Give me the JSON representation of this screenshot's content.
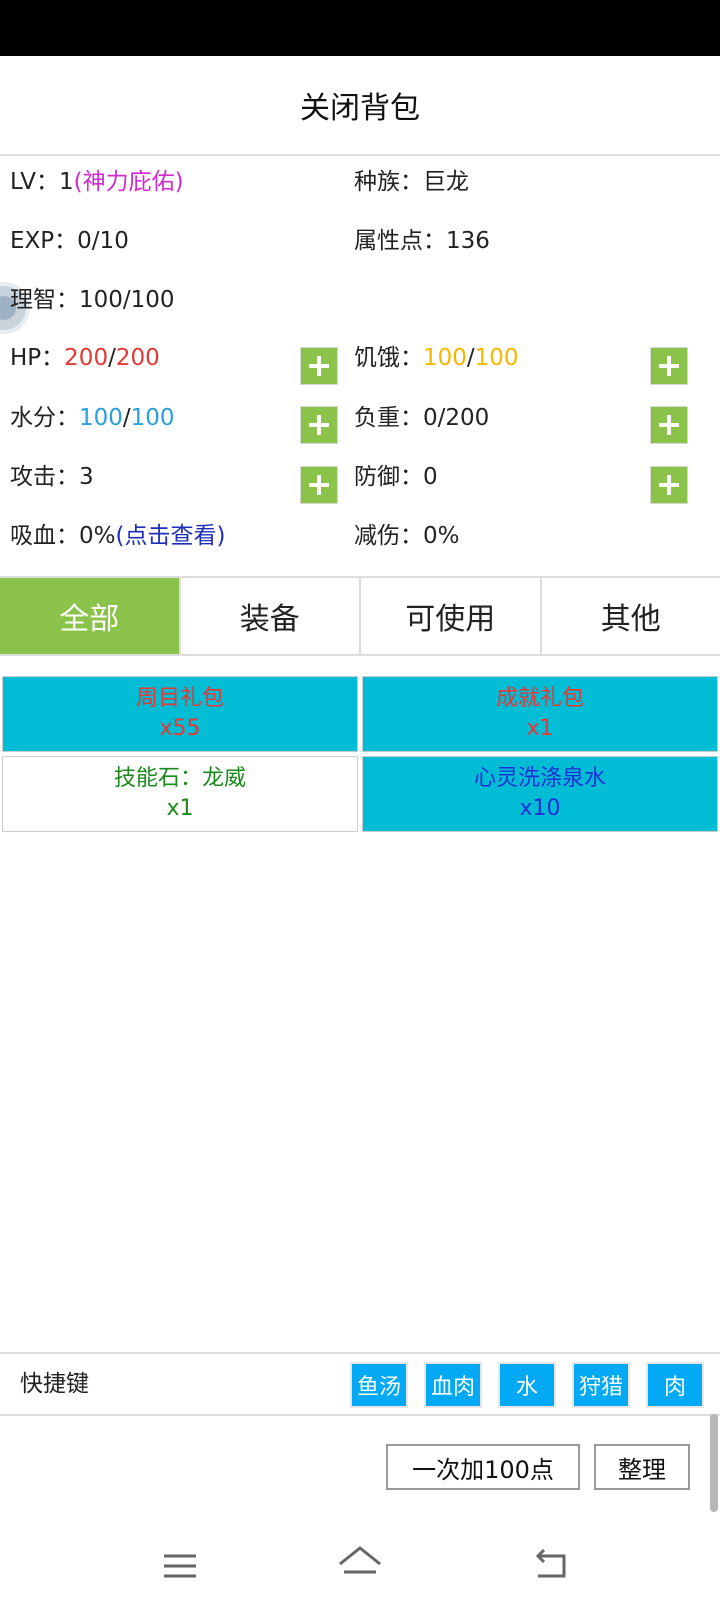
{
  "header": {
    "title": "关闭背包"
  },
  "stats": {
    "lv_label": "LV：",
    "lv_value": "1",
    "lv_note": "(神力庇佑)",
    "race_label": "种族：",
    "race_value": "巨龙",
    "exp_label": "EXP：",
    "exp_value": "0/10",
    "attr_label": "属性点：",
    "attr_value": "136",
    "sanity_label": "理智：",
    "sanity_value": "100/100",
    "hp_label": "HP：",
    "hp_current": "200",
    "hp_sep": "/",
    "hp_max": "200",
    "hunger_label": "饥饿：",
    "hunger_current": "100",
    "hunger_sep": "/",
    "hunger_max": "100",
    "water_label": "水分：",
    "water_current": "100",
    "water_sep": "/",
    "water_max": "100",
    "load_label": "负重：",
    "load_value": "0/200",
    "attack_label": "攻击：",
    "attack_value": "3",
    "defense_label": "防御：",
    "defense_value": "0",
    "lifesteal_label": "吸血：",
    "lifesteal_value": "0%",
    "lifesteal_link": "(点击查看)",
    "dmgreduce_label": "减伤：",
    "dmgreduce_value": "0%"
  },
  "tabs": [
    {
      "label": "全部",
      "active": true
    },
    {
      "label": "装备",
      "active": false
    },
    {
      "label": "可使用",
      "active": false
    },
    {
      "label": "其他",
      "active": false
    }
  ],
  "items": [
    {
      "name": "周目礼包",
      "count": "x55",
      "bg": "#00bcd4",
      "color": "#e53935"
    },
    {
      "name": "成就礼包",
      "count": "x1",
      "bg": "#00bcd4",
      "color": "#e53935"
    },
    {
      "name": "技能石：龙威",
      "count": "x1",
      "bg": "#ffffff",
      "color": "#1b8a1b"
    },
    {
      "name": "心灵洗涤泉水",
      "count": "x10",
      "bg": "#00bcd4",
      "color": "#1e2fd6"
    }
  ],
  "shortcuts": {
    "label": "快捷键",
    "buttons": [
      "鱼汤",
      "血肉",
      "水",
      "狩猎",
      "肉"
    ]
  },
  "actions": {
    "add100": "一次加100点",
    "sort": "整理"
  },
  "colors": {
    "green": "#8bc34a",
    "cyan": "#00bcd4",
    "blue_button": "#03a9f4",
    "hp_red": "#e53935",
    "hunger_yellow": "#f5b800",
    "water_blue": "#2a9fd8",
    "magenta": "#d12bd1",
    "link_blue": "#1e2fb8"
  }
}
